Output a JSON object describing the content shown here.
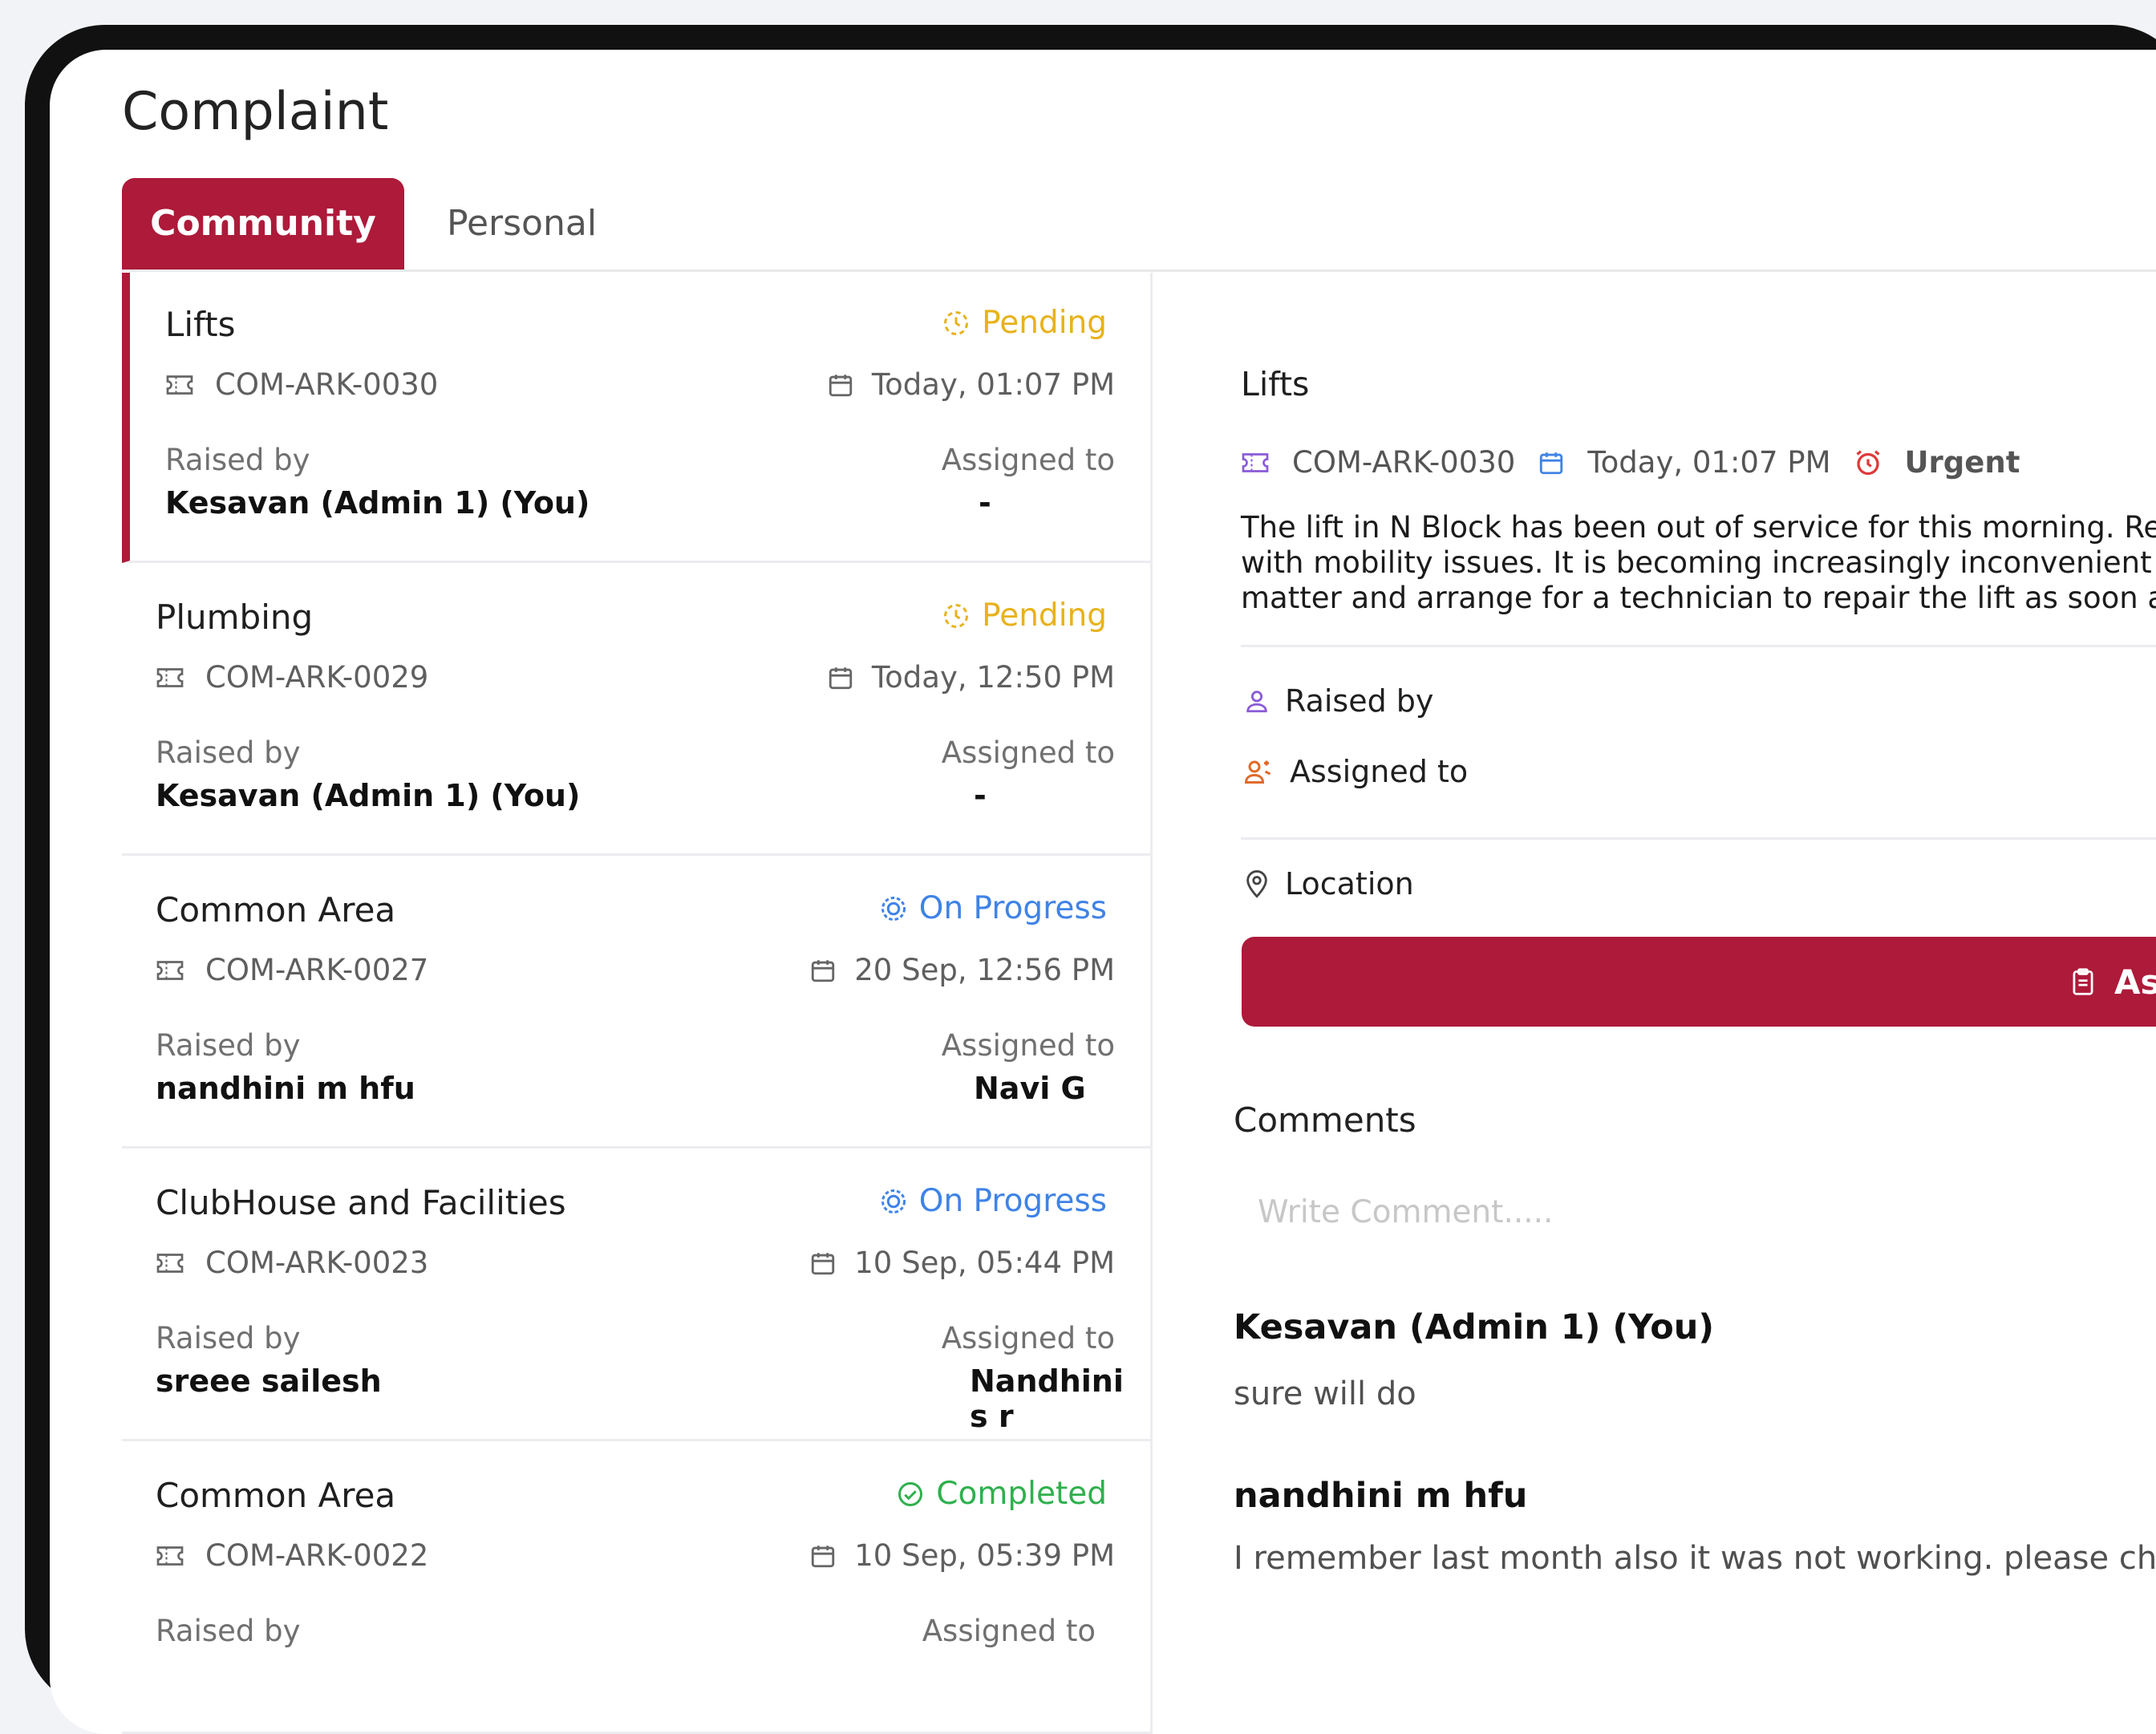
{
  "page": {
    "title": "Complaint"
  },
  "tabs": [
    {
      "label": "Community"
    },
    {
      "label": "Personal"
    }
  ],
  "labels": {
    "raised_by": "Raised by",
    "assigned_to": "Assigned to"
  },
  "complaints": [
    {
      "title": "Lifts",
      "status": "Pending",
      "id": "COM-ARK-0030",
      "date": "Today, 01:07 PM",
      "raised_by": "Kesavan (Admin 1) (You)",
      "assigned_to": "-"
    },
    {
      "title": "Plumbing",
      "status": "Pending",
      "id": "COM-ARK-0029",
      "date": "Today, 12:50 PM",
      "raised_by": "Kesavan (Admin 1) (You)",
      "assigned_to": "-"
    },
    {
      "title": "Common Area",
      "status": "On Progress",
      "id": "COM-ARK-0027",
      "date": "20 Sep, 12:56 PM",
      "raised_by": "nandhini m hfu",
      "assigned_to": "Navi G"
    },
    {
      "title": "ClubHouse and Facilities",
      "status": "On Progress",
      "id": "COM-ARK-0023",
      "date": "10 Sep, 05:44 PM",
      "raised_by": "sreee sailesh",
      "assigned_to": "Nandhini s r"
    },
    {
      "title": "Common Area",
      "status": "Completed",
      "id": "COM-ARK-0022",
      "date": "10 Sep, 05:39 PM",
      "raised_by": "",
      "assigned_to": ""
    }
  ],
  "detail": {
    "title": "Lifts",
    "id": "COM-ARK-0030",
    "date": "Today, 01:07 PM",
    "priority": "Urgent",
    "description_lines": [
      "The lift in N Block has been out of service for this morning. Resident",
      "with mobility issues. It is becoming increasingly inconvenient to us",
      "matter and arrange for a technician to repair the lift as soon as po"
    ],
    "raised_by_label": "Raised by",
    "assigned_to_label": "Assigned to",
    "location_label": "Location",
    "assign_button": "Assig"
  },
  "comments": {
    "title": "Comments",
    "placeholder": "Write Comment.....",
    "items": [
      {
        "author": "Kesavan (Admin 1) (You)",
        "text": "sure will do"
      },
      {
        "author": "nandhini m hfu",
        "text": "I remember last month also it was not working. please cha"
      }
    ]
  },
  "colors": {
    "brand": "#ad1a3a",
    "pending": "#e8b21b",
    "progress": "#3f83e6",
    "completed": "#2fb04d"
  }
}
